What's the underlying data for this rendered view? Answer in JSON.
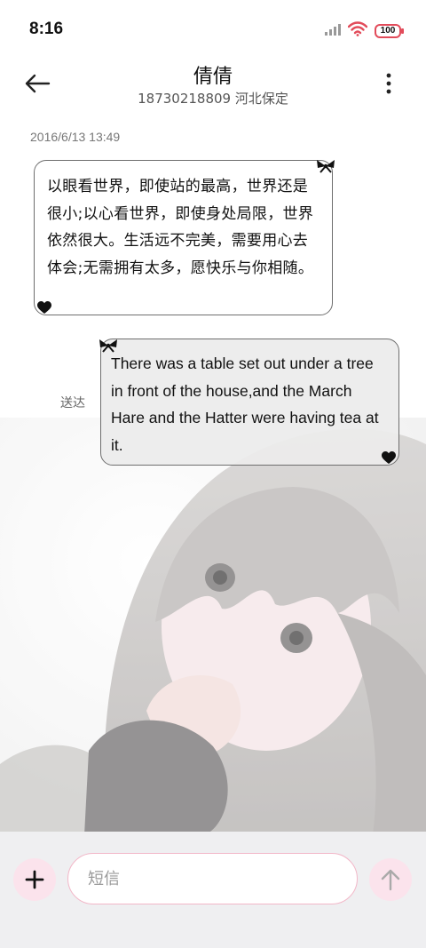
{
  "status_bar": {
    "time": "8:16",
    "battery": "100"
  },
  "header": {
    "contact_name": "倩倩",
    "contact_subtitle": "18730218809 河北保定"
  },
  "conversation": {
    "timestamp": "2016/6/13 13:49",
    "incoming_message": "以眼看世界，即使站的最高，世界还是很小;以心看世界，即使身处局限，世界依然很大。生活远不完美，需要用心去体会;无需拥有太多，愿快乐与你相随。",
    "outgoing_message": "There was a table set out under a tree in front of the house,and the March Hare and the Hatter were having tea at it.",
    "outgoing_status": "送达"
  },
  "compose": {
    "placeholder": "短信"
  },
  "icons": {
    "back": "arrow-left-icon",
    "more": "more-vertical-icon",
    "add": "plus-icon",
    "send": "arrow-up-icon",
    "signal": "signal-icon",
    "wifi": "wifi-icon",
    "bow": "bow-icon",
    "heart": "heart-icon"
  },
  "colors": {
    "accent_pink": "#fbe3ec",
    "input_border": "#f2b7c8",
    "battery_red": "#e24b5a"
  }
}
